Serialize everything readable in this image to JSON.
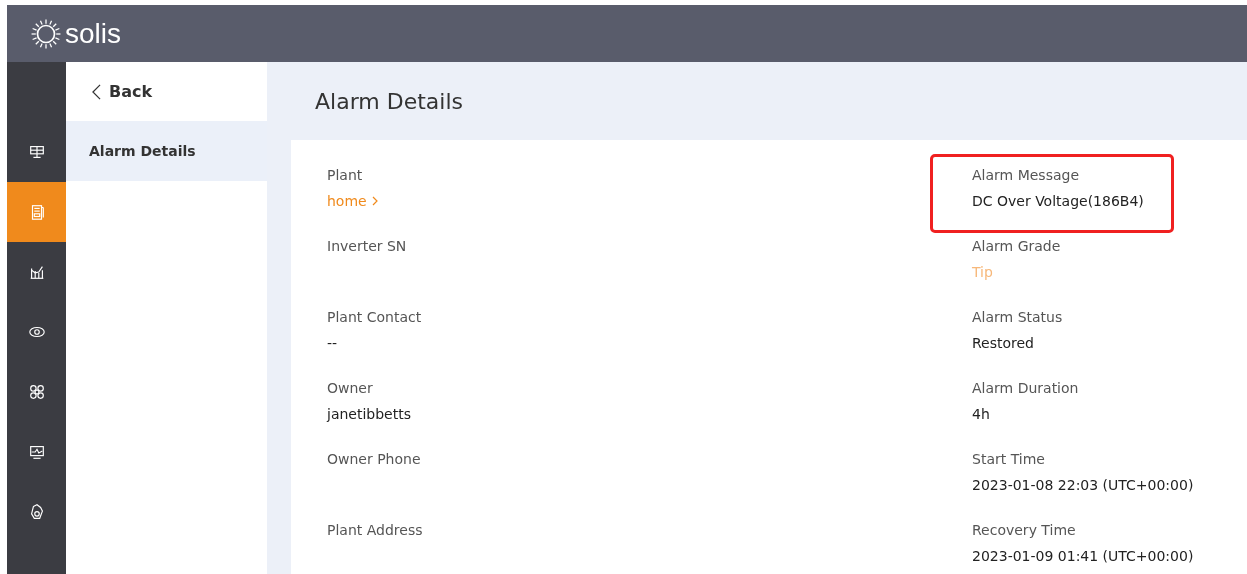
{
  "header": {
    "logo_text": "solis"
  },
  "rail": [
    {
      "selected": false
    },
    {
      "selected": true
    },
    {
      "selected": false
    },
    {
      "selected": false
    },
    {
      "selected": false
    },
    {
      "selected": false
    },
    {
      "selected": false
    }
  ],
  "nav": {
    "back": "Back",
    "items": [
      {
        "label": "Alarm Details",
        "selected": true
      }
    ]
  },
  "page_title": "Alarm Details",
  "left_fields": [
    {
      "label": "Plant",
      "value": "home",
      "kind": "link",
      "highlighted": false
    },
    {
      "label": "Inverter SN",
      "highlighted": false
    },
    {
      "label": "Plant Contact",
      "value": "--",
      "kind": "text",
      "highlighted": false
    },
    {
      "label": "Owner",
      "value": "janetibbetts",
      "kind": "text",
      "highlighted": false
    },
    {
      "label": "Owner Phone",
      "highlighted": false
    },
    {
      "label": "Plant Address",
      "highlighted": false
    }
  ],
  "right_fields": [
    {
      "label": "Alarm Message",
      "value": "DC Over Voltage(186B4)",
      "kind": "text",
      "highlighted": true
    },
    {
      "label": "Alarm Grade",
      "value": "Tip",
      "kind": "grade",
      "color": "#f7b87a",
      "highlighted": false
    },
    {
      "label": "Alarm Status",
      "value": "Restored",
      "kind": "text",
      "highlighted": false
    },
    {
      "label": "Alarm Duration",
      "value": "4h",
      "kind": "text",
      "highlighted": false
    },
    {
      "label": "Start Time",
      "value": "2023-01-08 22:03 (UTC+00:00)",
      "kind": "text",
      "highlighted": false
    },
    {
      "label": "Recovery Time",
      "value": "2023-01-09 01:41 (UTC+00:00)",
      "kind": "text",
      "highlighted": false
    }
  ]
}
